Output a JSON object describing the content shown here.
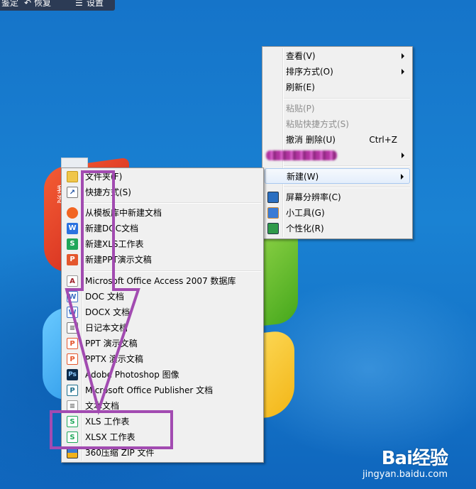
{
  "toolbar": {
    "item1": "鉴定",
    "item2": "恢复",
    "item3": "设置"
  },
  "desktop_icon_labels": [
    "我",
    "游"
  ],
  "context_menu": {
    "view": "查看(V)",
    "sort": "排序方式(O)",
    "refresh": "刷新(E)",
    "paste": "粘贴(P)",
    "paste_shortcut": "粘贴快捷方式(S)",
    "undo": "撤消 删除(U)",
    "undo_shortcut": "Ctrl+Z",
    "new": "新建(W)",
    "resolution": "屏幕分辨率(C)",
    "gadgets": "小工具(G)",
    "personalize": "个性化(R)"
  },
  "new_submenu": {
    "items": [
      "文件夹(F)",
      "快捷方式(S)",
      "从模板库中新建文档",
      "新建DOC文档",
      "新建XLS工作表",
      "新建PPT演示文稿",
      "Microsoft Office Access 2007 数据库",
      "DOC 文档",
      "DOCX 文档",
      "日记本文档",
      "PPT 演示文稿",
      "PPTX 演示文稿",
      "Adobe Photoshop 图像",
      "Microsoft Office Publisher 文档",
      "文本文档",
      "XLS 工作表",
      "XLSX 工作表",
      "360压缩 ZIP 文件"
    ]
  },
  "colors": {
    "annotation": "#a24bb1",
    "menu_bg": "#f0f0f0",
    "desktop": "#1a82d3"
  },
  "watermark": {
    "logo": "Bai经验",
    "url": "jingyan.baidu.com"
  }
}
